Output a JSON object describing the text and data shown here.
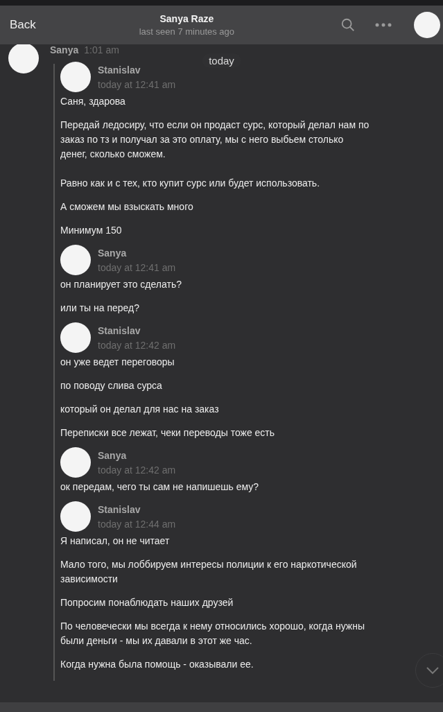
{
  "header": {
    "back": "Back",
    "title": "Sanya Raze",
    "status": "last seen 7 minutes ago"
  },
  "date_separator": "today",
  "top_message": {
    "author": "Sanya",
    "time": "1:01 am"
  },
  "forwarded": [
    {
      "author": "Stanislav",
      "time": "today at 12:41 am",
      "texts": [
        "Саня, здарова",
        "Передай ледосиру, что если он продаст сурс, который делал нам по заказ по тз и получал за это оплату, мы с него выбьем столько денег, сколько сможем.\n\nРавно как и с тех, кто купит сурс или будет использовать.",
        "А сможем мы взыскать много",
        "Минимум 150"
      ]
    },
    {
      "author": "Sanya",
      "time": "today at 12:41 am",
      "texts": [
        "он планирует это сделать?",
        "или ты на перед?"
      ]
    },
    {
      "author": "Stanislav",
      "time": "today at 12:42 am",
      "texts": [
        "он уже ведет переговоры",
        "по поводу слива сурса",
        "который он делал для нас на заказ",
        "Переписки все лежат, чеки переводы тоже есть"
      ]
    },
    {
      "author": "Sanya",
      "time": "today at 12:42 am",
      "texts": [
        "ок передам, чего ты сам не напишешь ему?"
      ]
    },
    {
      "author": "Stanislav",
      "time": "today at 12:44 am",
      "texts": [
        "Я написал, он не читает",
        "Мало того, мы лоббируем интересы полиции к его наркотической зависимости",
        "Попросим понаблюдать наших друзей",
        "По человечески мы всегда к нему относились хорошо, когда нужны были деньги - мы их давали в этот же час.",
        "Когда нужна была помощь - оказывали ее."
      ]
    }
  ]
}
